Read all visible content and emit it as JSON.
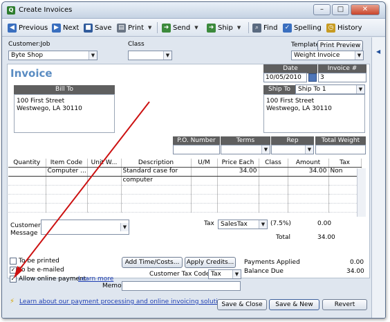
{
  "window": {
    "title": "Create Invoices",
    "controls": {
      "minimize": "–",
      "maximize": "□",
      "close": "✕"
    }
  },
  "toolbar": {
    "previous": "Previous",
    "next": "Next",
    "save": "Save",
    "print": "Print",
    "send": "Send",
    "ship": "Ship",
    "find": "Find",
    "spelling": "Spelling",
    "history": "History"
  },
  "header": {
    "customer_label": "Customer:Job",
    "customer_value": "Byte Shop",
    "class_label": "Class",
    "class_value": "",
    "template_label": "Template",
    "print_preview": "Print Preview",
    "template_value": "Weight Invoice"
  },
  "invoice": {
    "title": "Invoice",
    "date_label": "Date",
    "date_value": "10/05/2010",
    "number_label": "Invoice #",
    "number_value": "3",
    "bill_to_label": "Bill To",
    "bill_to_line1": "100 First Street",
    "bill_to_line2": "Westwego, LA  30110",
    "ship_to_label": "Ship To",
    "ship_to_select": "Ship To 1",
    "ship_to_line1": "100 First Street",
    "ship_to_line2": "Westwego, LA  30110",
    "po_label": "P.O. Number",
    "terms_label": "Terms",
    "rep_label": "Rep",
    "total_weight_label": "Total Weight"
  },
  "items_table": {
    "columns": [
      "Quantity",
      "Item Code",
      "Unit W...",
      "Description",
      "U/M",
      "Price Each",
      "Class",
      "Amount",
      "Tax"
    ],
    "rows": [
      [
        "",
        "Computer ...",
        "",
        "Standard case for",
        "",
        "34.00",
        "",
        "34.00",
        "Non"
      ],
      [
        "",
        "",
        "",
        "computer",
        "",
        "",
        "",
        "",
        ""
      ],
      [
        "",
        "",
        "",
        "",
        "",
        "",
        "",
        "",
        ""
      ],
      [
        "",
        "",
        "",
        "",
        "",
        "",
        "",
        "",
        ""
      ],
      [
        "",
        "",
        "",
        "",
        "",
        "",
        "",
        "",
        ""
      ]
    ]
  },
  "totals": {
    "customer_message_label_1": "Customer",
    "customer_message_label_2": "Message",
    "tax_label": "Tax",
    "tax_select": "SalesTax",
    "tax_rate": "(7.5%)",
    "tax_amount": "0.00",
    "total_label": "Total",
    "total_amount": "34.00"
  },
  "footer": {
    "to_be_printed": "To be printed",
    "to_be_emailed": "To be e-mailed",
    "allow_online_payment": "Allow online payment",
    "learn_more": "Learn more",
    "add_time_costs": "Add Time/Costs...",
    "apply_credits": "Apply Credits...",
    "customer_tax_code_label": "Customer Tax Code",
    "customer_tax_code_value": "Tax",
    "memo_label": "Memo",
    "memo_value": "",
    "payments_applied_label": "Payments Applied",
    "payments_applied_value": "0.00",
    "balance_due_label": "Balance Due",
    "balance_due_value": "34.00",
    "learn_payment_link": "Learn about our payment processing and online invoicing solutions.",
    "save_close": "Save & Close",
    "save_new": "Save & New",
    "revert": "Revert"
  },
  "checkboxes": {
    "to_be_printed": false,
    "to_be_emailed": true,
    "allow_online_payment": true
  },
  "colors": {
    "invoice_title": "#5a8cc2",
    "annotation_arrow": "#cc1111",
    "header_boxes": "#5f5f5f"
  }
}
